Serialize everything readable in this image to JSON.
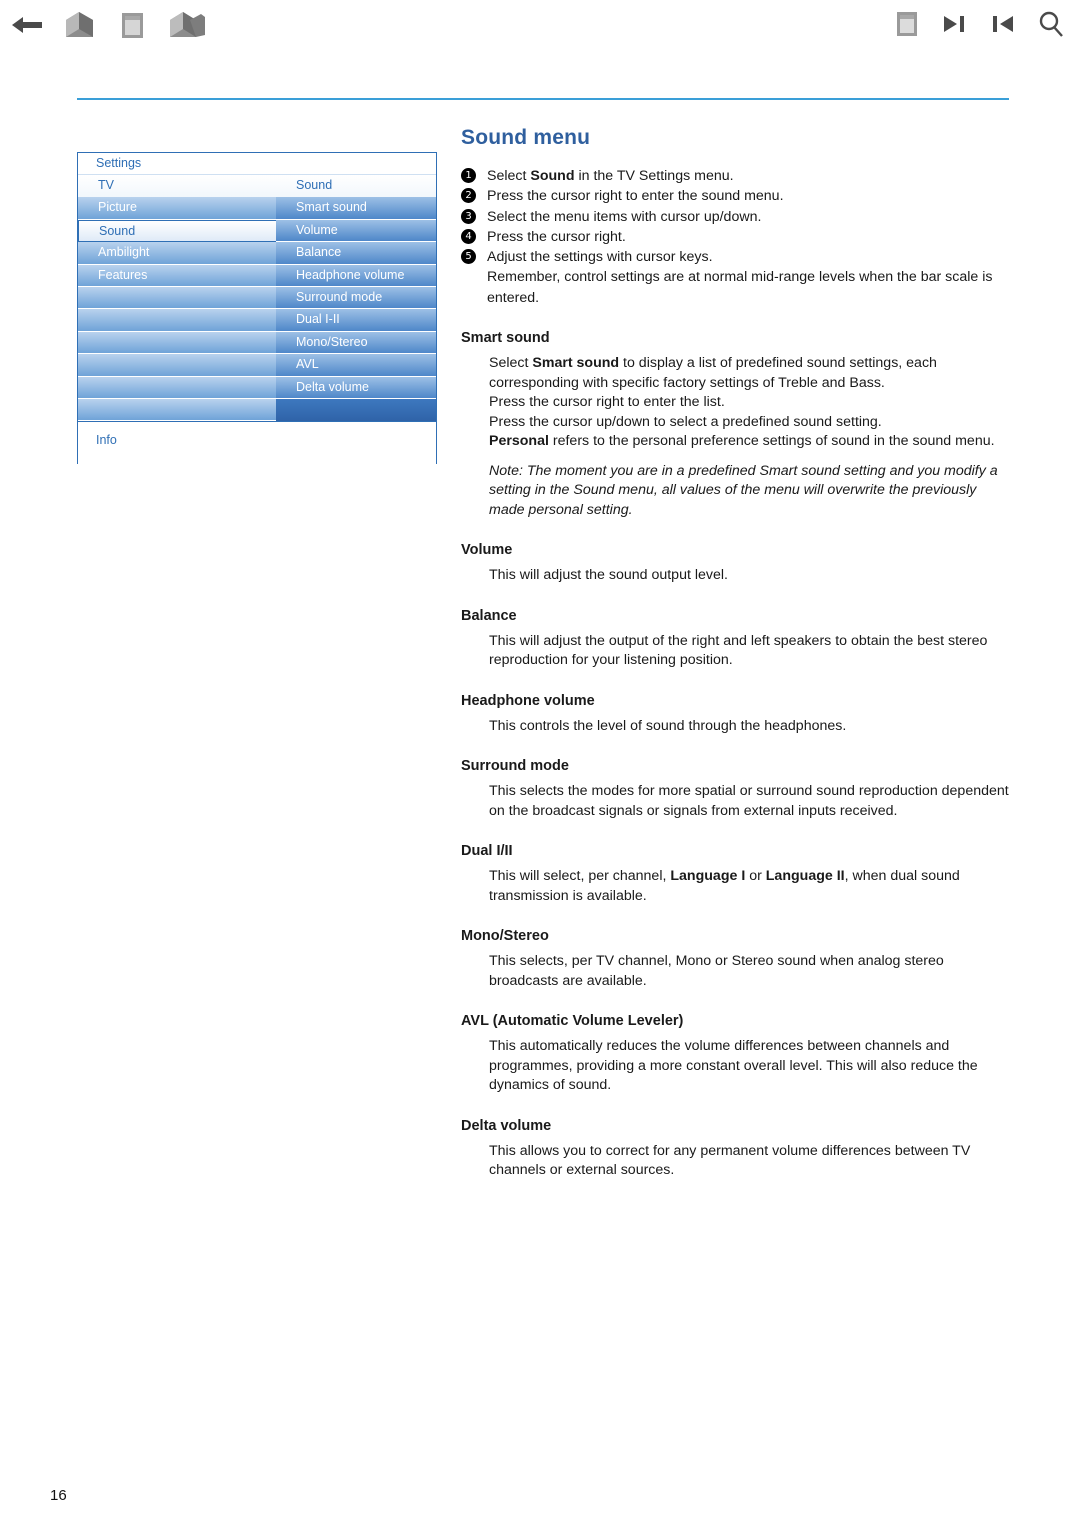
{
  "toolbar": {
    "left_icons": [
      {
        "name": "back-arrow-icon",
        "label": "Back"
      },
      {
        "name": "home-book-icon",
        "label": "Home"
      },
      {
        "name": "page-icon",
        "label": "Page"
      },
      {
        "name": "books-icon",
        "label": "Contents"
      }
    ],
    "right_icons": [
      {
        "name": "document-icon",
        "label": "Document"
      },
      {
        "name": "next-page-icon",
        "label": "Next"
      },
      {
        "name": "previous-page-icon",
        "label": "Previous"
      },
      {
        "name": "search-icon",
        "label": "Search"
      }
    ]
  },
  "tv_menu": {
    "header": "Settings",
    "left_column": {
      "title": "TV",
      "items": [
        "Picture",
        "Sound",
        "Ambilight",
        "Features"
      ],
      "selected": "Sound"
    },
    "right_column": {
      "title": "Sound",
      "items": [
        "Smart sound",
        "Volume",
        "Balance",
        "Headphone volume",
        "Surround mode",
        "Dual I-II",
        "Mono/Stereo",
        "AVL",
        "Delta volume"
      ]
    },
    "footer": "Info"
  },
  "article": {
    "title": "Sound menu",
    "steps": [
      {
        "num": "1",
        "pre": "Select ",
        "bold": "Sound",
        "post": " in the TV Settings menu."
      },
      {
        "num": "2",
        "pre": "Press the cursor right to enter the sound menu.",
        "bold": "",
        "post": ""
      },
      {
        "num": "3",
        "pre": "Select the menu items with cursor up/down.",
        "bold": "",
        "post": ""
      },
      {
        "num": "4",
        "pre": "Press the cursor right.",
        "bold": "",
        "post": ""
      },
      {
        "num": "5",
        "pre": "Adjust the settings with cursor keys.",
        "bold": "",
        "post": ""
      }
    ],
    "steps_note": "Remember, control settings are at normal mid-range levels when the bar scale is entered.",
    "sections": [
      {
        "heading": "Smart sound",
        "p1_a": "Select ",
        "p1_b": "Smart sound",
        "p1_c": " to display a list of predefined sound settings, each corresponding with specific factory settings of Treble and Bass.",
        "p2": "Press the cursor right to enter the list.",
        "p3": "Press the cursor up/down to select a predefined sound setting.",
        "p4_b": "Personal",
        "p4_c": " refers to the personal preference settings of sound in the sound menu.",
        "note": "Note: The moment you are in a predefined Smart sound setting and you modify a setting in the Sound menu, all values of the menu will overwrite the previously made personal setting."
      },
      {
        "heading": "Volume",
        "body": "This will adjust the sound output level."
      },
      {
        "heading": "Balance",
        "body": "This will adjust the output of the right and left speakers to obtain the best stereo reproduction for your listening position."
      },
      {
        "heading": "Headphone volume",
        "body": "This controls the level of sound through the headphones."
      },
      {
        "heading": "Surround mode",
        "body": "This selects the modes for more spatial or surround sound reproduction dependent on the broadcast signals or signals from external inputs received."
      },
      {
        "heading": "Dual I/II",
        "body_a": "This will select, per channel, ",
        "body_b1": "Language I",
        "body_mid": " or ",
        "body_b2": "Language II",
        "body_c": ", when dual sound transmission is available."
      },
      {
        "heading": "Mono/Stereo",
        "body": "This selects, per TV channel, Mono or Stereo sound when analog stereo broadcasts are available."
      },
      {
        "heading": "AVL (Automatic Volume Leveler)",
        "body": "This automatically reduces the volume differences between channels and programmes, providing a more constant overall level. This will also reduce the dynamics of sound."
      },
      {
        "heading": "Delta volume",
        "body": "This allows you to correct for any permanent volume differences between TV channels or external sources."
      }
    ]
  },
  "page_number": "16",
  "colors": {
    "title_blue": "#2f5f9e",
    "rule_blue": "#3a9fd8",
    "menu_border": "#2f6fb5"
  }
}
